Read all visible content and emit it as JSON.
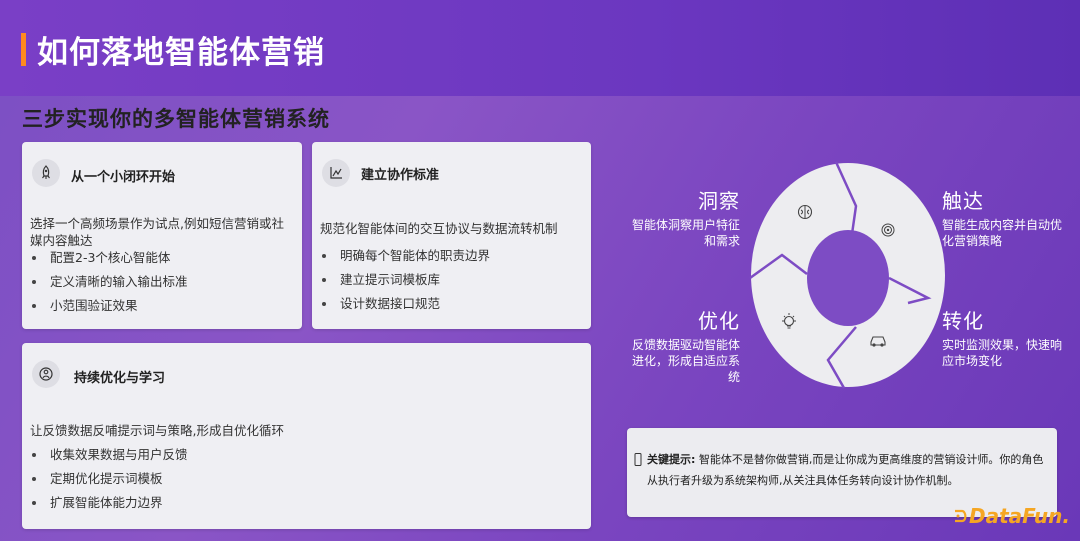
{
  "page": {
    "title": "如何落地智能体营销",
    "subtitle": "三步实现你的多智能体营销系统"
  },
  "cards": [
    {
      "title": "从一个小闭环开始",
      "icon": "rocket-icon",
      "lead": "选择一个高频场景作为试点,例如短信营销或社媒内容触达",
      "bullets": [
        "配置2-3个核心智能体",
        "定义清晰的输入输出标准",
        "小范围验证效果"
      ]
    },
    {
      "title": "建立协作标准",
      "icon": "flow-icon",
      "lead": "规范化智能体间的交互协议与数据流转机制",
      "bullets": [
        "明确每个智能体的职责边界",
        "建立提示词模板库",
        "设计数据接口规范"
      ]
    },
    {
      "title": "持续优化与学习",
      "icon": "learning-icon",
      "lead": "让反馈数据反哺提示词与策略,形成自优化循环",
      "bullets": [
        "收集效果数据与用户反馈",
        "定期优化提示词模板",
        "扩展智能体能力边界"
      ]
    }
  ],
  "cycle": {
    "stages": [
      {
        "title": "洞察",
        "desc": "智能体洞察用户特征和需求",
        "icon": "brain-icon"
      },
      {
        "title": "触达",
        "desc": "智能生成内容并自动优化营销策略",
        "icon": "fingerprint-icon"
      },
      {
        "title": "转化",
        "desc": "实时监测效果，快速响应市场变化",
        "icon": "car-icon"
      },
      {
        "title": "优化",
        "desc": "反馈数据驱动智能体进化，形成自适应系统",
        "icon": "bulb-icon"
      }
    ]
  },
  "tip": {
    "label": "关键提示:",
    "text": " 智能体不是替你做营销,而是让你成为更高维度的营销设计师。你的角色从执行者升级为系统架构师,从关注具体任务转向设计协作机制。"
  },
  "logo": {
    "text": "DataFun."
  },
  "colors": {
    "accent": "#ff8a1f",
    "background": "#7b4fc4",
    "card": "#efeff3",
    "logo": "#f5a623"
  }
}
